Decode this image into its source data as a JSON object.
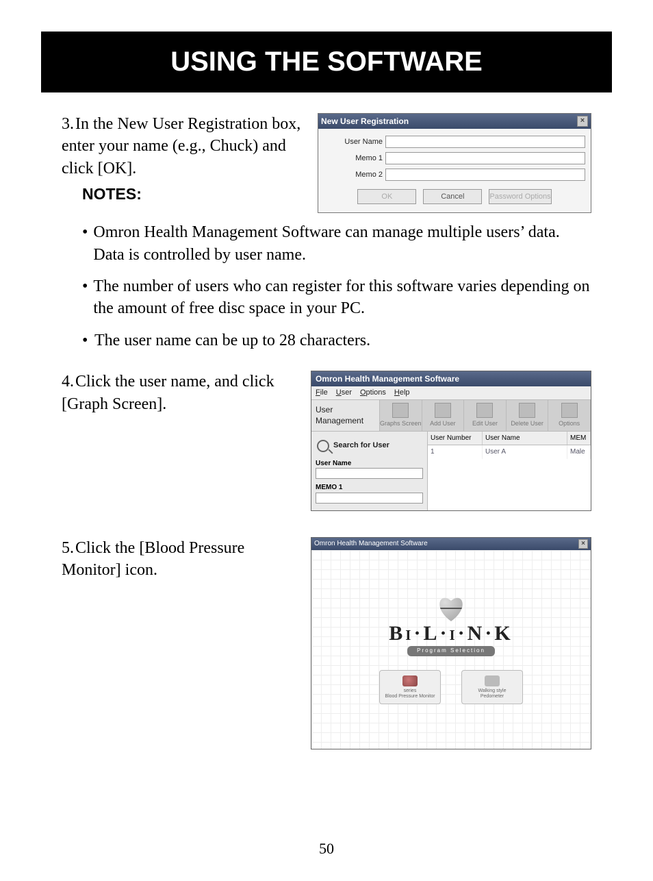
{
  "banner": "USING THE SOFTWARE",
  "page_number": "50",
  "step3": {
    "num": "3.",
    "text": "In the New User Registration box, enter your name (e.g., Chuck) and click [OK]."
  },
  "notes_label": "NOTES:",
  "notes": [
    "Omron Health Management Software can manage multiple users’ data. Data is controlled by user name.",
    "The number of users who can register for this software varies depending on the amount of free disc space in your PC.",
    "The user name can be up to 28 characters."
  ],
  "step4": {
    "num": "4.",
    "text": "Click the user name, and click [Graph Screen]."
  },
  "step5": {
    "num": "5.",
    "text": "Click the [Blood Pressure Monitor] icon."
  },
  "dialog1": {
    "title": "New User Registration",
    "fields": {
      "user_name": "User Name",
      "memo1": "Memo 1",
      "memo2": "Memo 2"
    },
    "buttons": {
      "ok": "OK",
      "cancel": "Cancel",
      "pw": "Password Options"
    }
  },
  "window2": {
    "title": "Omron Health Management Software",
    "menu": [
      "File",
      "User",
      "Options",
      "Help"
    ],
    "um_label": "User Management",
    "toolbar": [
      "Graphs Screen",
      "Add User",
      "Edit User",
      "Delete User",
      "Options"
    ],
    "search_header": "Search for User",
    "search_fields": [
      "User Name",
      "MEMO 1"
    ],
    "columns": [
      "User Number",
      "User Name",
      "MEM"
    ],
    "rows": [
      {
        "num": "1",
        "name": "User A",
        "mem": "Male"
      }
    ]
  },
  "window3": {
    "title": "Omron Health Management Software",
    "brand": "Bi·L·i·N·K",
    "subtitle": "Program Selection",
    "buttons": {
      "bpm_line1": "series",
      "bpm_line2": "Blood Pressure Monitor",
      "ped_line1": "Walking style",
      "ped_line2": "Pedometer"
    }
  }
}
